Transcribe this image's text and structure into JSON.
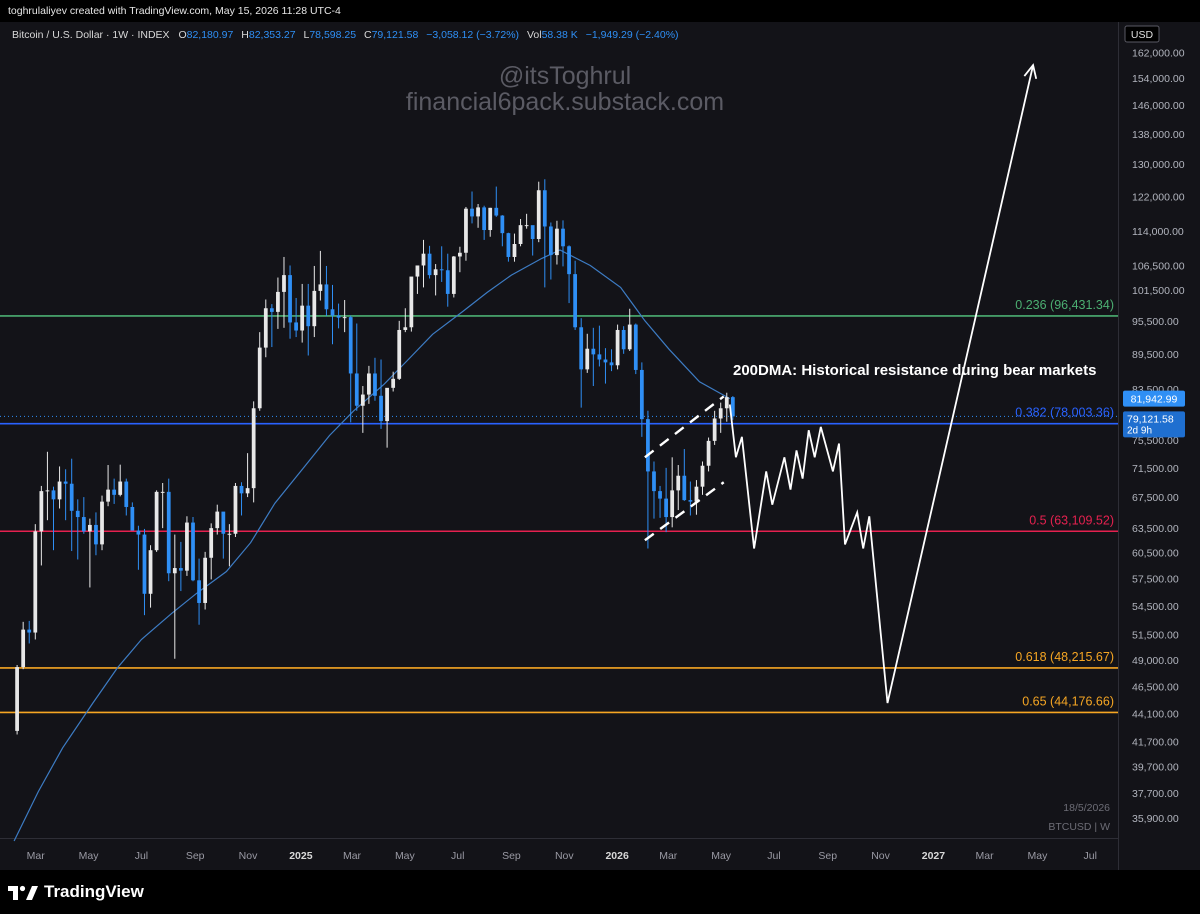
{
  "header": {
    "creator": "toghrulaliyev created with TradingView.com, May 15, 2026 11:28 UTC-4"
  },
  "legend": {
    "symbol": "Bitcoin / U.S. Dollar · 1W · INDEX",
    "o_label": "O",
    "o": "82,180.97",
    "h_label": "H",
    "h": "82,353.27",
    "l_label": "L",
    "l": "78,598.25",
    "c_label": "C",
    "c": "79,121.58",
    "chg": "−3,058.12 (−3.72%)",
    "vol_label": "Vol",
    "vol": "58.38 K",
    "vol_chg": "−1,949.29 (−2.40%)"
  },
  "watermark": {
    "handle": "@itsToghrul",
    "site": "financial6pack.substack.com"
  },
  "annotation": "200DMA: Historical resistance during bear markets",
  "price_tags": {
    "ma": "81,942.99",
    "last": "79,121.58",
    "countdown": "2d 9h"
  },
  "bottom_info": {
    "date": "18/5/2026",
    "symbol": "BTCUSD | W"
  },
  "footer": {
    "brand": "TradingView"
  },
  "colors": {
    "up": "#e8e8e8",
    "down": "#2f8ff5",
    "ma": "#3d7cc4",
    "fib_236": "#4caf72",
    "fib_382": "#2962ff",
    "fib_5": "#e5214f",
    "fib_618": "#f6a623",
    "fib_65": "#f6a623",
    "projection": "#ffffff",
    "background": "#131318"
  },
  "chart_data": {
    "type": "candlestick",
    "interval": "1W",
    "currency": "USD",
    "y_scale": "log",
    "ylim": [
      34500,
      172000
    ],
    "y_ticks": [
      162000,
      154000,
      146000,
      138000,
      130000,
      122000,
      114000,
      106500,
      101500,
      95500,
      89500,
      83500,
      75500,
      71500,
      67500,
      63500,
      60500,
      57500,
      54500,
      51500,
      49000,
      46500,
      44100,
      41700,
      39700,
      37700,
      35900
    ],
    "y_tick_labels": [
      "162,000.00",
      "154,000.00",
      "146,000.00",
      "138,000.00",
      "130,000.00",
      "122,000.00",
      "114,000.00",
      "106,500.00",
      "101,500.00",
      "95,500.00",
      "89,500.00",
      "83,500.00",
      "75,500.00",
      "71,500.00",
      "67,500.00",
      "63,500.00",
      "60,500.00",
      "57,500.00",
      "54,500.00",
      "51,500.00",
      "49,000.00",
      "46,500.00",
      "44,100.00",
      "41,700.00",
      "39,700.00",
      "37,700.00",
      "35,900.00"
    ],
    "x_range": [
      "2024-01-29",
      "2027-08-02"
    ],
    "x_ticks": [
      {
        "date": "2024-03-01",
        "label": "Mar"
      },
      {
        "date": "2024-05-01",
        "label": "May"
      },
      {
        "date": "2024-07-01",
        "label": "Jul"
      },
      {
        "date": "2024-09-01",
        "label": "Sep"
      },
      {
        "date": "2024-11-01",
        "label": "Nov"
      },
      {
        "date": "2025-01-01",
        "label": "2025",
        "bold": true
      },
      {
        "date": "2025-03-01",
        "label": "Mar"
      },
      {
        "date": "2025-05-01",
        "label": "May"
      },
      {
        "date": "2025-07-01",
        "label": "Jul"
      },
      {
        "date": "2025-09-01",
        "label": "Sep"
      },
      {
        "date": "2025-11-01",
        "label": "Nov"
      },
      {
        "date": "2026-01-01",
        "label": "2026",
        "bold": true
      },
      {
        "date": "2026-03-01",
        "label": "Mar"
      },
      {
        "date": "2026-05-01",
        "label": "May"
      },
      {
        "date": "2026-07-01",
        "label": "Jul"
      },
      {
        "date": "2026-09-01",
        "label": "Sep"
      },
      {
        "date": "2026-11-01",
        "label": "Nov"
      },
      {
        "date": "2027-01-01",
        "label": "2027",
        "bold": true
      },
      {
        "date": "2027-03-01",
        "label": "Mar"
      },
      {
        "date": "2027-05-01",
        "label": "May"
      },
      {
        "date": "2027-07-01",
        "label": "Jul"
      }
    ],
    "fib_levels": [
      {
        "ratio": "0.236",
        "price": 96431.34,
        "label": "0.236 (96,431.34)",
        "color": "#4caf72"
      },
      {
        "ratio": "0.382",
        "price": 78003.36,
        "label": "0.382 (78,003.36)",
        "color": "#2962ff"
      },
      {
        "ratio": "0.5",
        "price": 63109.52,
        "label": "0.5 (63,109.52)",
        "color": "#e5214f"
      },
      {
        "ratio": "0.618",
        "price": 48215.67,
        "label": "0.618 (48,215.67)",
        "color": "#f6a623"
      },
      {
        "ratio": "0.65",
        "price": 44176.66,
        "label": "0.65 (44,176.66)",
        "color": "#f6a623"
      }
    ],
    "candles": [
      [
        "2024-02-05",
        42600,
        48500,
        42300,
        48300
      ],
      [
        "2024-02-12",
        48300,
        52800,
        48100,
        52000
      ],
      [
        "2024-02-19",
        52000,
        52900,
        50600,
        51700
      ],
      [
        "2024-02-26",
        51700,
        64000,
        51000,
        63100
      ],
      [
        "2024-03-04",
        63100,
        69000,
        59000,
        68300
      ],
      [
        "2024-03-11",
        68300,
        73800,
        64500,
        68400
      ],
      [
        "2024-03-18",
        68400,
        68900,
        60800,
        67200
      ],
      [
        "2024-03-25",
        67200,
        71700,
        66000,
        69600
      ],
      [
        "2024-04-01",
        69600,
        71300,
        64500,
        69300
      ],
      [
        "2024-04-08",
        69300,
        72800,
        60700,
        65700
      ],
      [
        "2024-04-15",
        65700,
        67200,
        59700,
        64900
      ],
      [
        "2024-04-22",
        64900,
        67500,
        62800,
        63100
      ],
      [
        "2024-04-29",
        63100,
        64700,
        56500,
        63900
      ],
      [
        "2024-05-06",
        63900,
        65500,
        60200,
        61500
      ],
      [
        "2024-05-13",
        61500,
        67700,
        60800,
        66900
      ],
      [
        "2024-05-20",
        66900,
        71900,
        66300,
        68500
      ],
      [
        "2024-05-27",
        68500,
        70000,
        66600,
        67800
      ],
      [
        "2024-06-03",
        67800,
        71950,
        67600,
        69600
      ],
      [
        "2024-06-10",
        69600,
        70000,
        65100,
        66200
      ],
      [
        "2024-06-17",
        66200,
        66800,
        63400,
        63200
      ],
      [
        "2024-06-24",
        63200,
        63800,
        58500,
        62700
      ],
      [
        "2024-07-01",
        62700,
        63400,
        53500,
        55800
      ],
      [
        "2024-07-08",
        55800,
        61400,
        54300,
        60800
      ],
      [
        "2024-07-15",
        60800,
        68400,
        60600,
        68200
      ],
      [
        "2024-07-22",
        68200,
        69400,
        63500,
        68200
      ],
      [
        "2024-07-29",
        68200,
        70000,
        57200,
        58100
      ],
      [
        "2024-08-05",
        58100,
        62700,
        49100,
        58700
      ],
      [
        "2024-08-12",
        58700,
        61800,
        56100,
        58400
      ],
      [
        "2024-08-19",
        58400,
        65000,
        57800,
        64200
      ],
      [
        "2024-08-26",
        64200,
        64900,
        57200,
        57300
      ],
      [
        "2024-09-02",
        57300,
        59800,
        52500,
        54800
      ],
      [
        "2024-09-09",
        54800,
        60600,
        54100,
        59900
      ],
      [
        "2024-09-16",
        59900,
        64100,
        57400,
        63500
      ],
      [
        "2024-09-23",
        63500,
        66500,
        62700,
        65600
      ],
      [
        "2024-09-30",
        65600,
        65200,
        59800,
        62800
      ],
      [
        "2024-10-07",
        62800,
        64000,
        58900,
        62800
      ],
      [
        "2024-10-14",
        62800,
        69400,
        62400,
        69000
      ],
      [
        "2024-10-21",
        69000,
        69500,
        65100,
        68000
      ],
      [
        "2024-10-28",
        68000,
        73600,
        67500,
        68700
      ],
      [
        "2024-11-04",
        68700,
        81500,
        66800,
        80400
      ],
      [
        "2024-11-11",
        80400,
        93400,
        80000,
        90600
      ],
      [
        "2024-11-18",
        90600,
        99600,
        88900,
        97900
      ],
      [
        "2024-11-25",
        97900,
        98700,
        90700,
        97200
      ],
      [
        "2024-12-02",
        97200,
        104000,
        94000,
        101100
      ],
      [
        "2024-12-09",
        101100,
        108300,
        94200,
        104500
      ],
      [
        "2024-12-16",
        104500,
        106500,
        92200,
        95200
      ],
      [
        "2024-12-23",
        95200,
        99900,
        92500,
        93700
      ],
      [
        "2024-12-30",
        93700,
        102700,
        91500,
        98400
      ],
      [
        "2025-01-06",
        98400,
        102700,
        89200,
        94500
      ],
      [
        "2025-01-13",
        94500,
        106400,
        92500,
        101300
      ],
      [
        "2025-01-20",
        101300,
        109600,
        99400,
        102600
      ],
      [
        "2025-01-27",
        102600,
        106400,
        96400,
        97700
      ],
      [
        "2025-02-03",
        97700,
        102500,
        91200,
        96500
      ],
      [
        "2025-02-10",
        96500,
        98800,
        94100,
        96100
      ],
      [
        "2025-02-17",
        96100,
        99500,
        93400,
        96200
      ],
      [
        "2025-02-24",
        96200,
        96500,
        78200,
        86100
      ],
      [
        "2025-03-03",
        86100,
        95000,
        80000,
        80800
      ],
      [
        "2025-03-10",
        80800,
        84000,
        76600,
        82600
      ],
      [
        "2025-03-17",
        82600,
        87400,
        81100,
        86100
      ],
      [
        "2025-03-24",
        86100,
        88800,
        81600,
        82400
      ],
      [
        "2025-03-31",
        82400,
        88500,
        77200,
        78400
      ],
      [
        "2025-04-07",
        78400,
        83600,
        74400,
        83700
      ],
      [
        "2025-04-14",
        83700,
        86400,
        83100,
        85200
      ],
      [
        "2025-04-21",
        85200,
        95500,
        85000,
        93800
      ],
      [
        "2025-04-28",
        93800,
        97900,
        93400,
        94300
      ],
      [
        "2025-05-05",
        94300,
        104100,
        93500,
        104200
      ],
      [
        "2025-05-12",
        104200,
        105800,
        100700,
        106500
      ],
      [
        "2025-05-19",
        106500,
        112000,
        102000,
        109000
      ],
      [
        "2025-05-26",
        109000,
        110700,
        103800,
        104500
      ],
      [
        "2025-06-02",
        104500,
        106800,
        100400,
        105700
      ],
      [
        "2025-06-09",
        105700,
        110600,
        103100,
        105500
      ],
      [
        "2025-06-16",
        105500,
        109000,
        98200,
        100700
      ],
      [
        "2025-06-23",
        100700,
        108500,
        100000,
        108400
      ],
      [
        "2025-06-30",
        108400,
        110500,
        105100,
        109200
      ],
      [
        "2025-07-07",
        109200,
        119500,
        107500,
        119100
      ],
      [
        "2025-07-14",
        119100,
        123200,
        115700,
        117300
      ],
      [
        "2025-07-21",
        117300,
        120200,
        114700,
        119400
      ],
      [
        "2025-07-28",
        119400,
        119800,
        112000,
        114200
      ],
      [
        "2025-08-04",
        114200,
        119300,
        112700,
        119300
      ],
      [
        "2025-08-11",
        119300,
        124400,
        117200,
        117500
      ],
      [
        "2025-08-18",
        117500,
        117600,
        110600,
        113500
      ],
      [
        "2025-08-25",
        113500,
        113600,
        107300,
        108300
      ],
      [
        "2025-09-01",
        108300,
        113400,
        107300,
        111100
      ],
      [
        "2025-09-08",
        111100,
        116700,
        110600,
        115300
      ],
      [
        "2025-09-15",
        115300,
        117900,
        114500,
        115300
      ],
      [
        "2025-09-22",
        115300,
        113900,
        108600,
        112200
      ],
      [
        "2025-09-29",
        112200,
        125600,
        111500,
        123500
      ],
      [
        "2025-10-06",
        123500,
        126200,
        102000,
        115000
      ],
      [
        "2025-10-13",
        115000,
        115900,
        103600,
        108700
      ],
      [
        "2025-10-20",
        108700,
        116300,
        106700,
        114500
      ],
      [
        "2025-10-27",
        114500,
        116400,
        106300,
        110600
      ],
      [
        "2025-11-03",
        110600,
        110800,
        98900,
        104700
      ],
      [
        "2025-11-10",
        104700,
        107500,
        93800,
        94300
      ],
      [
        "2025-11-17",
        94300,
        96000,
        80500,
        86800
      ],
      [
        "2025-11-24",
        86800,
        93100,
        86200,
        90400
      ],
      [
        "2025-12-01",
        90400,
        94200,
        84000,
        89400
      ],
      [
        "2025-12-08",
        89400,
        94600,
        87300,
        88500
      ],
      [
        "2025-12-15",
        88500,
        90500,
        84400,
        88000
      ],
      [
        "2025-12-22",
        88000,
        90300,
        86500,
        87500
      ],
      [
        "2025-12-29",
        87500,
        94800,
        86800,
        93800
      ],
      [
        "2026-01-05",
        93800,
        94500,
        89500,
        90300
      ],
      [
        "2026-01-12",
        90300,
        97800,
        90000,
        94800
      ],
      [
        "2026-01-19",
        94800,
        95000,
        86000,
        86700
      ],
      [
        "2026-01-26",
        86700,
        88000,
        76000,
        78700
      ],
      [
        "2026-02-02",
        78700,
        80000,
        61000,
        71000
      ],
      [
        "2026-02-09",
        71000,
        72400,
        64700,
        68300
      ],
      [
        "2026-02-16",
        68300,
        69000,
        64800,
        67300
      ],
      [
        "2026-02-23",
        67300,
        71500,
        63000,
        64900
      ],
      [
        "2026-03-02",
        64900,
        73000,
        63600,
        68400
      ],
      [
        "2026-03-09",
        68400,
        71900,
        65800,
        70400
      ],
      [
        "2026-03-16",
        70400,
        74200,
        67000,
        67100
      ],
      [
        "2026-03-23",
        67100,
        69600,
        65100,
        66900
      ],
      [
        "2026-03-30",
        66900,
        69800,
        65200,
        68900
      ],
      [
        "2026-04-06",
        68900,
        72400,
        67800,
        71800
      ],
      [
        "2026-04-13",
        71800,
        75900,
        71000,
        75400
      ],
      [
        "2026-04-20",
        75400,
        80000,
        74800,
        78800
      ],
      [
        "2026-04-27",
        78800,
        81300,
        76600,
        80400
      ],
      [
        "2026-05-04",
        80400,
        82900,
        78300,
        82180
      ],
      [
        "2026-05-11",
        82180.97,
        82353.27,
        78598.25,
        79121.58
      ]
    ],
    "ma_series": [
      [
        "2024-02-05",
        34300
      ],
      [
        "2024-03-04",
        37800
      ],
      [
        "2024-04-01",
        41200
      ],
      [
        "2024-05-06",
        45000
      ],
      [
        "2024-06-03",
        48200
      ],
      [
        "2024-07-01",
        51000
      ],
      [
        "2024-08-05",
        53700
      ],
      [
        "2024-09-02",
        55800
      ],
      [
        "2024-10-07",
        58300
      ],
      [
        "2024-11-04",
        61700
      ],
      [
        "2024-12-02",
        66700
      ],
      [
        "2025-01-06",
        71800
      ],
      [
        "2025-02-03",
        76200
      ],
      [
        "2025-03-03",
        80000
      ],
      [
        "2025-04-07",
        84300
      ],
      [
        "2025-05-05",
        88500
      ],
      [
        "2025-06-02",
        93000
      ],
      [
        "2025-07-07",
        97300
      ],
      [
        "2025-08-04",
        101000
      ],
      [
        "2025-09-01",
        104500
      ],
      [
        "2025-10-06",
        108000
      ],
      [
        "2025-10-27",
        109800
      ],
      [
        "2025-12-01",
        106500
      ],
      [
        "2026-01-05",
        102000
      ],
      [
        "2026-02-02",
        95500
      ],
      [
        "2026-03-02",
        90300
      ],
      [
        "2026-04-06",
        84700
      ],
      [
        "2026-05-11",
        81942.99
      ]
    ],
    "projection_path": [
      [
        "2026-05-11",
        81000
      ],
      [
        "2026-05-18",
        73000
      ],
      [
        "2026-05-25",
        76000
      ],
      [
        "2026-06-08",
        61000
      ],
      [
        "2026-06-22",
        71000
      ],
      [
        "2026-06-29",
        66500
      ],
      [
        "2026-07-13",
        73000
      ],
      [
        "2026-07-20",
        68500
      ],
      [
        "2026-07-27",
        74000
      ],
      [
        "2026-08-03",
        70000
      ],
      [
        "2026-08-10",
        77000
      ],
      [
        "2026-08-17",
        73000
      ],
      [
        "2026-08-24",
        77500
      ],
      [
        "2026-09-07",
        71000
      ],
      [
        "2026-09-14",
        75000
      ],
      [
        "2026-09-21",
        61500
      ],
      [
        "2026-10-05",
        65500
      ],
      [
        "2026-10-12",
        61000
      ],
      [
        "2026-10-19",
        65000
      ],
      [
        "2026-11-09",
        45000
      ],
      [
        "2027-04-26",
        158000
      ]
    ],
    "channel": {
      "lower": [
        [
          "2026-02-02",
          62000
        ],
        [
          "2026-05-04",
          69500
        ]
      ],
      "upper": [
        [
          "2026-02-02",
          73000
        ],
        [
          "2026-05-04",
          82300
        ]
      ]
    },
    "last_price": 79121.58,
    "ma_last": 81942.99
  }
}
